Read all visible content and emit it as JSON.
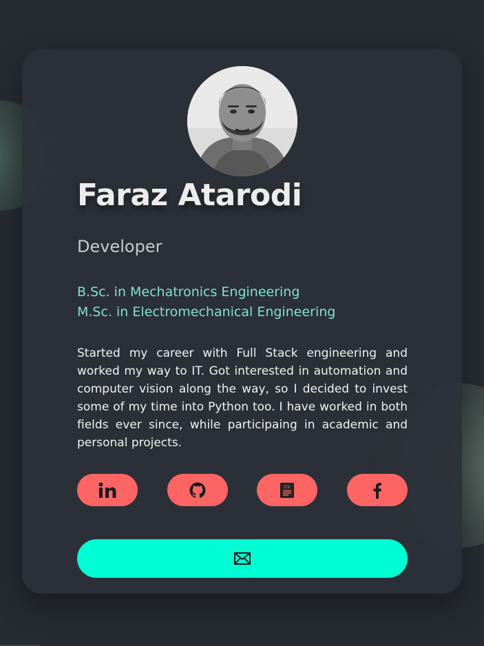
{
  "profile": {
    "name": "Faraz Atarodi",
    "role": "Developer",
    "degrees": [
      "B.Sc. in Mechatronics Engineering",
      "M.Sc. in Electromechanical Engineering"
    ],
    "bio": "Started my career with Full Stack engineering and worked my way to IT. Got interested in automation and computer vision along the way, so I decided to invest some of my time into Python too. I have worked in both fields ever since, while participaing in academic and personal projects."
  },
  "socials": [
    {
      "icon": "linkedin-icon"
    },
    {
      "icon": "github-icon"
    },
    {
      "icon": "cv-icon",
      "badge": "CV"
    },
    {
      "icon": "facebook-icon"
    }
  ],
  "contact": {
    "icon": "mail-icon"
  },
  "colors": {
    "background": "#262b32",
    "card": "#2c3138",
    "accent_red": "#fd6565",
    "accent_cyan": "#00fcd2",
    "degree_text": "#7fe3cf"
  }
}
